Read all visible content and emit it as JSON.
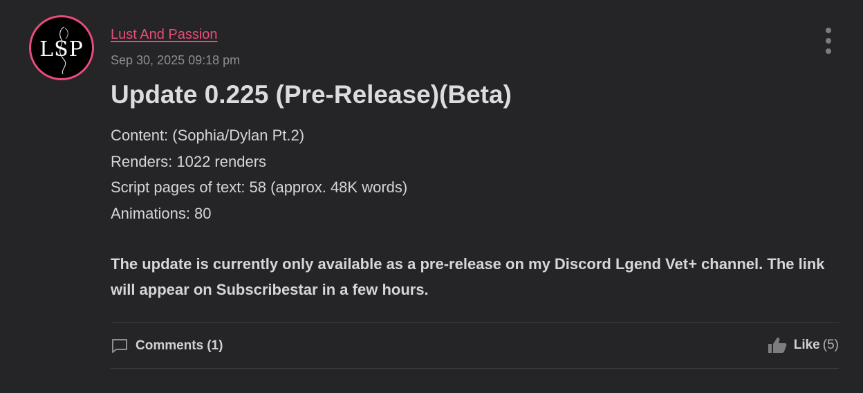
{
  "author": {
    "name": "Lust And Passion",
    "avatar_monogram": "LSP",
    "accent_color": "#ea4c79"
  },
  "post": {
    "timestamp": "Sep 30, 2025 09:18 pm",
    "title": "Update 0.225 (Pre-Release)(Beta)",
    "details": [
      "Content: (Sophia/Dylan Pt.2)",
      "Renders: 1022 renders",
      "Script pages of text: 58 (approx. 48K words)",
      "Animations: 80"
    ],
    "notice": "The update is currently only available as a pre-release on my Discord Lgend Vet+ channel. The link will appear on Subscribestar in a few hours."
  },
  "footer": {
    "comments_label": "Comments",
    "comments_count": "(1)",
    "like_label": "Like",
    "like_count": "(5)"
  },
  "icons": {
    "menu": "more-vertical-icon",
    "comments": "comment-icon",
    "like": "thumbs-up-icon"
  },
  "colors": {
    "background": "#252427",
    "accent": "#ea4c79"
  }
}
